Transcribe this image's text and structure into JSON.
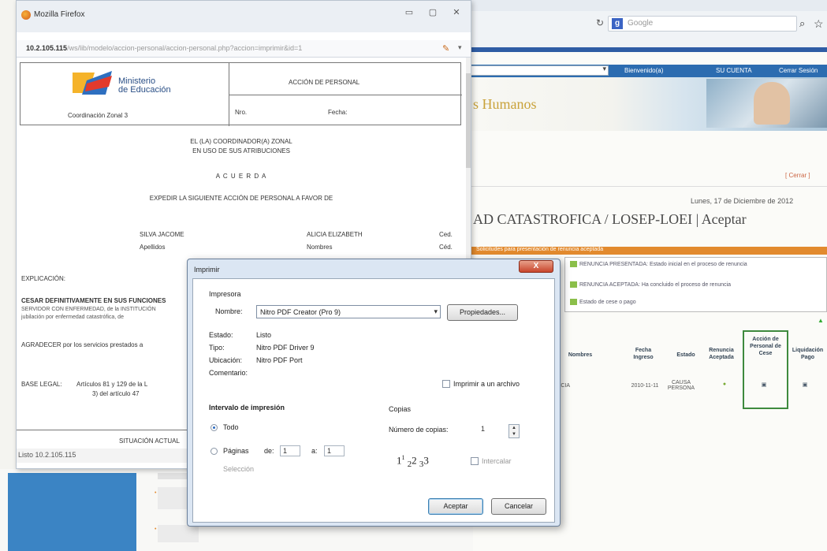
{
  "firefox": {
    "title": "Mozilla Firefox",
    "url_host": "10.2.105.115",
    "url_path": "/ws/lib/modelo/accion-personal/accion-personal.php?accion=imprimir&id=1",
    "status_text": "Listo 10.2.105.115"
  },
  "document": {
    "ministerio_line1": "Ministerio",
    "ministerio_line2": "de Educación",
    "coordinacion": "Coordinación Zonal 3",
    "accion_title": "ACCIÓN DE PERSONAL",
    "nro_label": "Nro.",
    "fecha_label": "Fecha:",
    "line1": "EL (LA) COORDINADOR(A) ZONAL",
    "line2": "EN USO DE SUS ATRIBUCIONES",
    "acuerda": "A C U E R D A",
    "expedir": "EXPEDIR LA SIGUIENTE ACCIÓN DE PERSONAL A FAVOR DE",
    "apellido_value": "SILVA JACOME",
    "apellidos_label": "Apellidos",
    "nombre_value": "ALICIA ELIZABETH",
    "nombres_label": "Nombres",
    "ced_value": "Ced.",
    "ced_label": "Céd.",
    "explicacion": "EXPLICACIÓN:",
    "cesar": "CESAR DEFINITIVAMENTE EN SUS FUNCIONES",
    "cesar_sub1": "SERVIDOR CON ENFERMEDAD, de la INSTITUCIÓN",
    "cesar_sub2": "jubilación por enfermedad catastrófica, de",
    "agradecer": "AGRADECER por los servicios prestados a",
    "base_label": "BASE LEGAL:",
    "base_value": "Artículos 81 y 129 de la L",
    "base_value2": "3) del artículo 47",
    "situacion": "SITUACIÓN ACTUAL"
  },
  "print_dialog": {
    "title": "Imprimir",
    "close_label": "X",
    "printer_group": "Impresora",
    "name_label": "Nombre:",
    "printer_name": "Nitro PDF Creator (Pro 9)",
    "properties_btn": "Propiedades...",
    "status_label": "Estado:",
    "status_value": "Listo",
    "type_label": "Tipo:",
    "type_value": "Nitro PDF Driver 9",
    "location_label": "Ubicación:",
    "location_value": "Nitro PDF Port",
    "comment_label": "Comentario:",
    "print_to_file": "Imprimir a un archivo",
    "range_group": "Intervalo de impresión",
    "all_option": "Todo",
    "pages_option": "Páginas",
    "from_label": "de:",
    "from_value": "1",
    "to_label": "a:",
    "to_value": "1",
    "selection_option": "Selección",
    "copies_group": "Copias",
    "copies_label": "Número de copias:",
    "copies_value": "1",
    "collate_label": "Intercalar",
    "accept_btn": "Aceptar",
    "cancel_btn": "Cancelar"
  },
  "background": {
    "search_placeholder": "Google",
    "nav_1": "Bienvenido(a)",
    "nav_2": "SU CUENTA",
    "nav_3": "Cerrar Sesión",
    "banner_title": "s Humanos",
    "right_link": "[ Cerrar ]",
    "date": "Lunes, 17 de Diciembre de 2012",
    "page_title": "AD CATASTROFICA / LOSEP-LOEI | Aceptar",
    "orange_bar": "Solicitudes para presentación de renuncia aceptada",
    "status_lines": [
      "RENUNCIA PRESENTADA: Estado inicial en el proceso de renuncia",
      "RENUNCIA ACEPTADA: Ha concluido el proceso de renuncia",
      "Estado de cese o pago"
    ],
    "table_headers": [
      "Nombres",
      "Fecha Ingreso",
      "Estado",
      "Renuncia Aceptada",
      "Acción de Personal de Cese",
      "Liquidación Pago"
    ],
    "row_name": "ALICIA",
    "row_date": "2010-11-11",
    "row_state": "CAUSA PERSONA"
  }
}
